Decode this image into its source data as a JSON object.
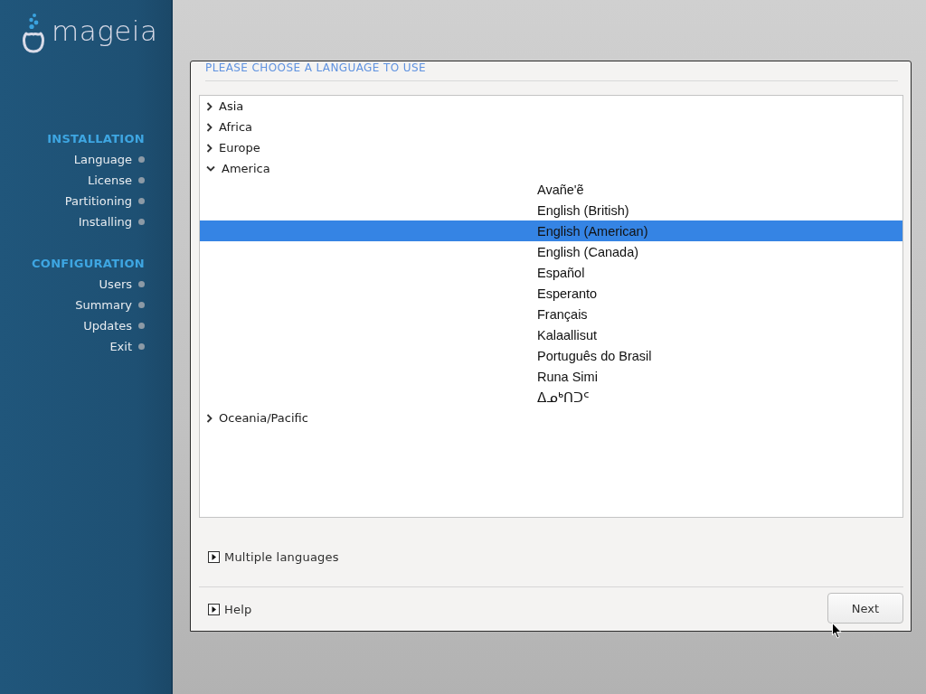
{
  "sidebar": {
    "logo": {
      "wordmark": "mageia"
    },
    "sections": [
      {
        "title": "INSTALLATION",
        "steps": [
          {
            "label": "Language"
          },
          {
            "label": "License"
          },
          {
            "label": "Partitioning"
          },
          {
            "label": "Installing"
          }
        ]
      },
      {
        "title": "CONFIGURATION",
        "steps": [
          {
            "label": "Users"
          },
          {
            "label": "Summary"
          },
          {
            "label": "Updates"
          },
          {
            "label": "Exit"
          }
        ]
      }
    ]
  },
  "panel": {
    "title": "PLEASE CHOOSE A LANGUAGE TO USE",
    "language_tree": [
      {
        "label": "Asia",
        "expanded": false
      },
      {
        "label": "Africa",
        "expanded": false
      },
      {
        "label": "Europe",
        "expanded": false
      },
      {
        "label": "America",
        "expanded": true,
        "children": [
          {
            "label": "Avañe'ẽ",
            "selected": false
          },
          {
            "label": "English (British)",
            "selected": false
          },
          {
            "label": "English (American)",
            "selected": true
          },
          {
            "label": "English (Canada)",
            "selected": false
          },
          {
            "label": "Español",
            "selected": false
          },
          {
            "label": "Esperanto",
            "selected": false
          },
          {
            "label": "Français",
            "selected": false
          },
          {
            "label": "Kalaallisut",
            "selected": false
          },
          {
            "label": "Português do Brasil",
            "selected": false
          },
          {
            "label": "Runa Simi",
            "selected": false
          },
          {
            "label": "ᐃᓄᒃᑎᑐᑦ",
            "selected": false
          }
        ]
      },
      {
        "label": "Oceania/Pacific",
        "expanded": false
      }
    ],
    "multiple_languages": {
      "label": "Multiple languages",
      "expanded": false
    },
    "help": {
      "label": "Help",
      "expanded": false
    },
    "next_button": {
      "label": "Next"
    }
  }
}
